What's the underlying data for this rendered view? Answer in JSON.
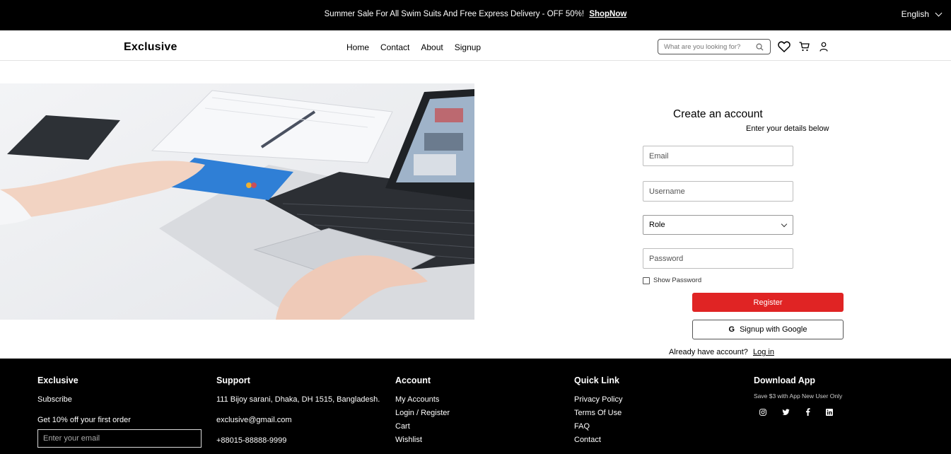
{
  "topbar": {
    "promo_text": "Summer Sale For All Swim Suits And Free Express Delivery - OFF 50%!",
    "promo_link": "ShopNow",
    "language": "English"
  },
  "header": {
    "logo": "Exclusive",
    "nav": [
      "Home",
      "Contact",
      "About",
      "Signup"
    ],
    "search_placeholder": "What are you looking for?",
    "icons": [
      "search-icon",
      "heart-icon",
      "cart-icon",
      "user-icon"
    ]
  },
  "form": {
    "title": "Create an account",
    "subtitle": "Enter your details below",
    "email_placeholder": "Email",
    "username_placeholder": "Username",
    "role_selected": "Role",
    "password_placeholder": "Password",
    "show_password_label": "Show Password",
    "register_label": "Register",
    "google_label": "Signup with Google",
    "google_glyph": "G",
    "already_text": "Already have account?",
    "login_link": "Log in"
  },
  "footer": {
    "col1": {
      "title": "Exclusive",
      "subscribe": "Subscribe",
      "offer": "Get 10% off your first order",
      "email_placeholder": "Enter your email"
    },
    "col2": {
      "title": "Support",
      "address": "111 Bijoy sarani, Dhaka, DH 1515, Bangladesh.",
      "email": "exclusive@gmail.com",
      "phone": "+88015-88888-9999"
    },
    "col3": {
      "title": "Account",
      "items": [
        "My Accounts",
        "Login / Register",
        "Cart",
        "Wishlist"
      ]
    },
    "col4": {
      "title": "Quick Link",
      "items": [
        "Privacy Policy",
        "Terms Of Use",
        "FAQ",
        "Contact"
      ]
    },
    "col5": {
      "title": "Download App",
      "note": "Save $3 with App New User Only",
      "social": [
        "instagram-icon",
        "twitter-icon",
        "facebook-icon",
        "linkedin-icon"
      ]
    }
  },
  "colors": {
    "accent": "#e02424",
    "topbar_bg": "#000000",
    "footer_bg": "#000000"
  }
}
